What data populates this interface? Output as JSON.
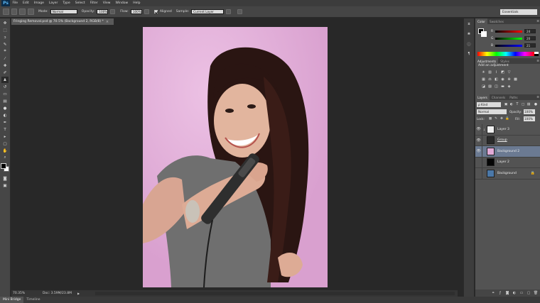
{
  "app": {
    "logo": "Ps"
  },
  "menu": [
    "File",
    "Edit",
    "Image",
    "Layer",
    "Type",
    "Select",
    "Filter",
    "View",
    "Window",
    "Help"
  ],
  "options": {
    "mode_label": "Mode:",
    "mode_value": "Normal",
    "opacity_label": "Opacity:",
    "opacity_value": "100%",
    "flow_label": "Flow:",
    "flow_value": "100%",
    "aligned_label": "Aligned",
    "sample_label": "Sample:",
    "sample_value": "Current Layer",
    "workspace": "Essentials"
  },
  "document": {
    "tab_title": "Fringing Removal.psd @ 70.5% (Background 2, RGB/8) *",
    "close": "×",
    "zoom": "70.35%",
    "doc_info": "Doc: 3.59M/23.8M"
  },
  "tools": [
    "move",
    "marquee",
    "lasso",
    "quick-select",
    "crop",
    "eyedropper",
    "healing",
    "brush",
    "clone-stamp",
    "history-brush",
    "eraser",
    "gradient",
    "blur",
    "dodge",
    "pen",
    "type",
    "path-select",
    "shape",
    "hand",
    "zoom"
  ],
  "bottom_tabs": [
    "Mini Bridge",
    "Timeline"
  ],
  "panels": {
    "color": {
      "tabs": [
        "Color",
        "Swatches"
      ],
      "sliders": [
        {
          "letter": "R",
          "value": "24",
          "gradient": "linear-gradient(to right,#000,#ff0000)"
        },
        {
          "letter": "G",
          "value": "20",
          "gradient": "linear-gradient(to right,#000,#00ff00)"
        },
        {
          "letter": "B",
          "value": "21",
          "gradient": "linear-gradient(to right,#000,#0000ff)"
        }
      ]
    },
    "adjustments": {
      "tabs": [
        "Adjustments",
        "Styles"
      ],
      "title": "Add an adjustment"
    },
    "layers": {
      "tabs": [
        "Layers",
        "Channels",
        "Paths"
      ],
      "filter_kind": "ρ Kind",
      "blend_mode": "Normal",
      "opacity_label": "Opacity:",
      "opacity_value": "100%",
      "lock_label": "Lock:",
      "fill_label": "Fill:",
      "fill_value": "100%",
      "items": [
        {
          "name": "Layer 3",
          "thumb": "#f0f0f0",
          "visible": true,
          "selected": false,
          "clipped": true,
          "underline": false,
          "locked": false
        },
        {
          "name": "Group",
          "thumb": "#2a2a2a",
          "visible": true,
          "selected": false,
          "clipped": false,
          "underline": true,
          "locked": false
        },
        {
          "name": "Background 2",
          "thumb": "#e1aad7",
          "visible": true,
          "selected": true,
          "clipped": false,
          "underline": false,
          "locked": false
        },
        {
          "name": "Layer 2",
          "thumb": "#050505",
          "visible": false,
          "selected": false,
          "clipped": false,
          "underline": false,
          "locked": false
        },
        {
          "name": "Background",
          "thumb": "#4b78a8",
          "visible": false,
          "selected": false,
          "clipped": false,
          "underline": false,
          "locked": true
        }
      ]
    }
  },
  "colors": {
    "canvas_background": "#e1aad7",
    "selected_layer": "#6b7a92",
    "panel_bg": "#535353"
  }
}
